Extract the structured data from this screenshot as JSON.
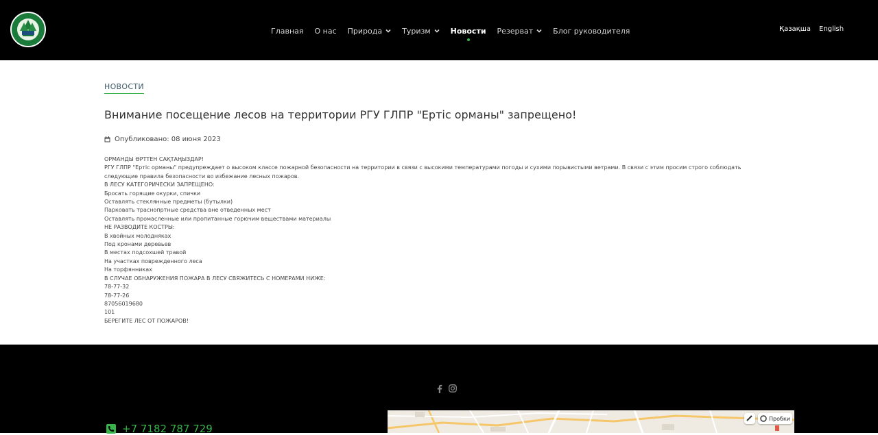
{
  "header": {
    "nav": [
      {
        "label": "Главная",
        "dropdown": false,
        "active": false
      },
      {
        "label": "О нас",
        "dropdown": false,
        "active": false
      },
      {
        "label": "Природа",
        "dropdown": true,
        "active": false
      },
      {
        "label": "Туризм",
        "dropdown": true,
        "active": false
      },
      {
        "label": "Новости",
        "dropdown": false,
        "active": true
      },
      {
        "label": "Резерват",
        "dropdown": true,
        "active": false
      },
      {
        "label": "Блог руководителя",
        "dropdown": false,
        "active": false
      }
    ],
    "languages": [
      "Қазақша",
      "English"
    ]
  },
  "main": {
    "section_label": "НОВОСТИ",
    "article_title": "Внимание посещение лесов на территории РГУ ГЛПР \"Ертіс орманы\" запрещено!",
    "published": "Опубликовано: 08 июня 2023",
    "body": [
      "ОРМАНДЫ ӨРТТЕН САҚТАҢЫЗДАР!",
      "РГУ ГЛПР \"Ертіс орманы\" предупреждает о высоком классе пожарной безопасности на территории в связи с высокими температурами погоды и сухими порывистыми ветрами. В связи с этим просим строго соблюдать следующие правила безопасности во избежание лесных пожаров.",
      "В ЛЕСУ КАТЕГОРИЧЕСКИ ЗАПРЕЩЕНО:",
      "Бросать горящие окурки, спички",
      "Оставлять стеклянные предметы (бутылки)",
      "Парковать траснопртные средства вне отведенных мест",
      "Оставлять промасленные или пропитанные горючим веществами материалы",
      "НЕ РАЗВОДИТЕ КОСТРЫ:",
      "В хвойных молодняках",
      "Под кронами деревьев",
      "В местах подсохшей травой",
      "На участках поврежденного леса",
      "На торфянниках",
      "В СЛУЧАЕ ОБНАРУЖЕНИЯ ПОЖАРА В ЛЕСУ СВЯЖИТЕСЬ С НОМЕРАМИ НИЖЕ:",
      "78-77-32",
      "78-77-26",
      "87056019680",
      "101",
      "БЕРЕГИТЕ ЛЕС ОТ ПОЖАРОВ!"
    ]
  },
  "footer": {
    "phone": "+7 7182 787 729",
    "map": {
      "traffic_label": "Пробки"
    },
    "social_icons": [
      "facebook-icon",
      "instagram-icon"
    ]
  },
  "colors": {
    "accent": "#39b44a",
    "header_bg": "#000000",
    "footer_bg": "#000000"
  }
}
